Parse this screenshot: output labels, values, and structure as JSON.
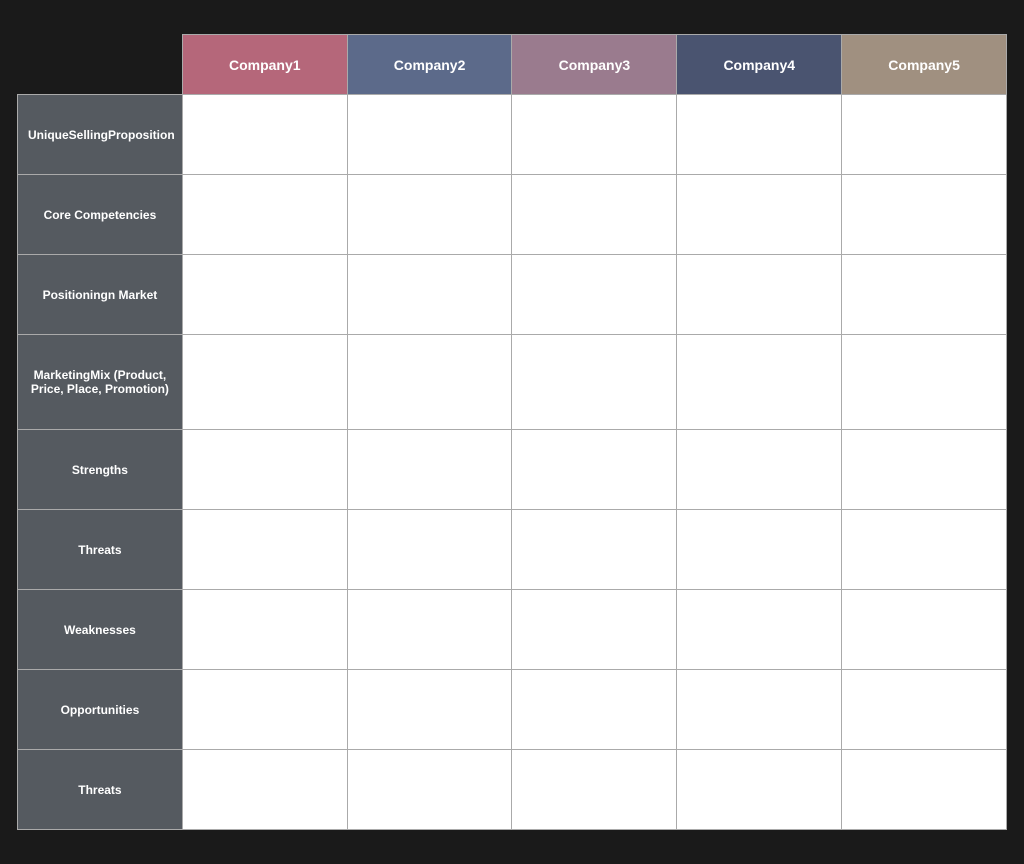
{
  "header": {
    "companies": [
      {
        "id": "company1",
        "label": "Company1",
        "colorClass": "col-company1"
      },
      {
        "id": "company2",
        "label": "Company2",
        "colorClass": "col-company2"
      },
      {
        "id": "company3",
        "label": "Company3",
        "colorClass": "col-company3"
      },
      {
        "id": "company4",
        "label": "Company4",
        "colorClass": "col-company4"
      },
      {
        "id": "company5",
        "label": "Company5",
        "colorClass": "col-company5"
      }
    ]
  },
  "rows": [
    {
      "id": "unique-selling",
      "label": "UniqueSellingProposition",
      "extraClass": ""
    },
    {
      "id": "core-competencies",
      "label": "Core Competencies",
      "extraClass": ""
    },
    {
      "id": "positioning-market",
      "label": "Positioningn Market",
      "extraClass": ""
    },
    {
      "id": "marketing-mix",
      "label": "MarketingMix (Product, Price, Place, Promotion)",
      "extraClass": "row-marketing"
    },
    {
      "id": "strengths",
      "label": "Strengths",
      "extraClass": ""
    },
    {
      "id": "threats-1",
      "label": "Threats",
      "extraClass": ""
    },
    {
      "id": "weaknesses",
      "label": "Weaknesses",
      "extraClass": ""
    },
    {
      "id": "opportunities",
      "label": "Opportunities",
      "extraClass": ""
    },
    {
      "id": "threats-2",
      "label": "Threats",
      "extraClass": ""
    }
  ]
}
